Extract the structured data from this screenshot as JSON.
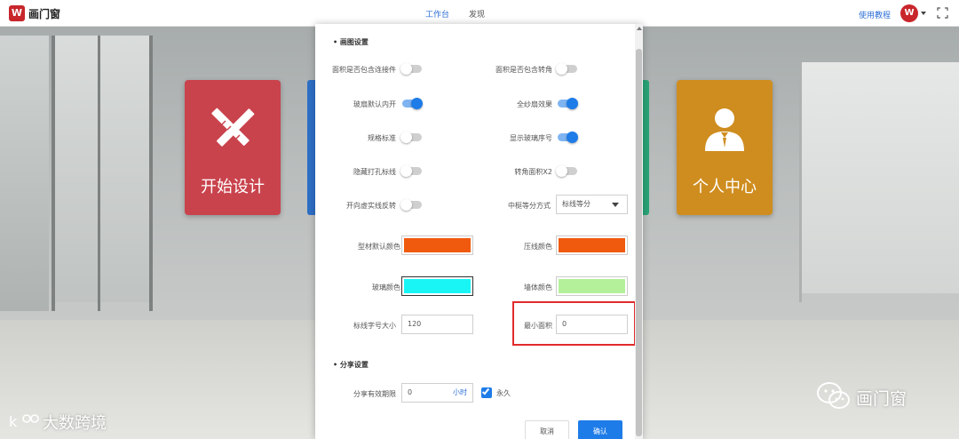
{
  "app": {
    "logo_text": "W",
    "brand": "画门窗"
  },
  "nav": {
    "tabs": [
      {
        "label": "工作台"
      },
      {
        "label": "发现"
      }
    ],
    "tutorial": "使用教程",
    "avatar_text": "W"
  },
  "home_cards": {
    "design": "开始设计",
    "personal": "个人中心"
  },
  "dialog": {
    "drawing_section": "• 画图设置",
    "toggles": {
      "area_include_connector": {
        "label": "面积是否包含连接件",
        "on": false
      },
      "area_include_corner": {
        "label": "面积是否包含转角",
        "on": false
      },
      "sash_default_inward": {
        "label": "玻扇默认内开",
        "on": true
      },
      "full_screen_effect": {
        "label": "全纱扇效果",
        "on": true
      },
      "dimension_standard": {
        "label": "规格标准",
        "on": false
      },
      "show_glass_number": {
        "label": "显示玻璃序号",
        "on": true
      },
      "hide_hole_dimension": {
        "label": "隐藏打孔标线",
        "on": false
      },
      "corner_area_x2": {
        "label": "转角面积X2",
        "on": false
      },
      "open_direction_reverse": {
        "label": "开向虚实线反转",
        "on": false
      }
    },
    "mullion_split": {
      "label": "中梃等分方式",
      "value": "标线等分"
    },
    "colors": {
      "profile_default": {
        "label": "型材默认颜色",
        "value": "#f05a0e"
      },
      "bead": {
        "label": "压线颜色",
        "value": "#f05a0e"
      },
      "glass": {
        "label": "玻璃颜色",
        "value": "#19f5f5"
      },
      "wall": {
        "label": "墙体颜色",
        "value": "#b4f09a"
      }
    },
    "dim_font_size": {
      "label": "标线字号大小",
      "value": "120"
    },
    "min_area": {
      "label": "最小面积",
      "value": "0"
    },
    "share_section": "• 分享设置",
    "share_valid": {
      "label": "分享有效期限",
      "value": "0",
      "unit": "小时"
    },
    "forever": {
      "label": "永久",
      "checked": true
    },
    "cancel_label": "取消",
    "confirm_label": "确认"
  },
  "watermarks": {
    "left": "大数跨境",
    "right": "画门窗"
  },
  "accent_colors": {
    "primary": "#1e7ce8",
    "highlight": "#e02b2b",
    "card_red": "#c9434d",
    "card_orange": "#cf8d1f"
  }
}
